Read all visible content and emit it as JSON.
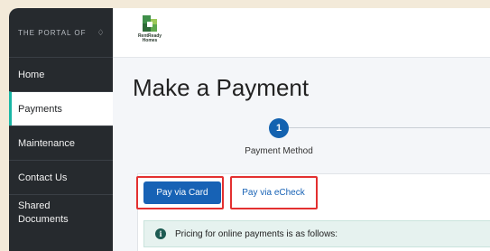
{
  "sidebar": {
    "portal_title": "THE PORTAL OF",
    "bell_icon": "bell-icon",
    "items": [
      {
        "label": "Home"
      },
      {
        "label": "Payments",
        "active": true
      },
      {
        "label": "Maintenance"
      },
      {
        "label": "Contact Us"
      },
      {
        "label_line1": "Shared",
        "label_line2": "Documents"
      }
    ]
  },
  "header": {
    "logo_line1": "RentReady",
    "logo_line2": "Homes"
  },
  "main": {
    "title": "Make a Payment",
    "step": {
      "number": "1",
      "label": "Payment Method"
    },
    "buttons": {
      "card_label": "Pay via Card",
      "echeck_label": "Pay via eCheck"
    },
    "info": {
      "icon": "info-icon",
      "text": "Pricing for online payments is as follows:"
    }
  },
  "colors": {
    "sidebar_bg": "#262a2e",
    "accent": "#1762b5",
    "active_border": "#1ab6a5",
    "highlight": "#e33030",
    "info_bg": "#e6f2ef"
  }
}
